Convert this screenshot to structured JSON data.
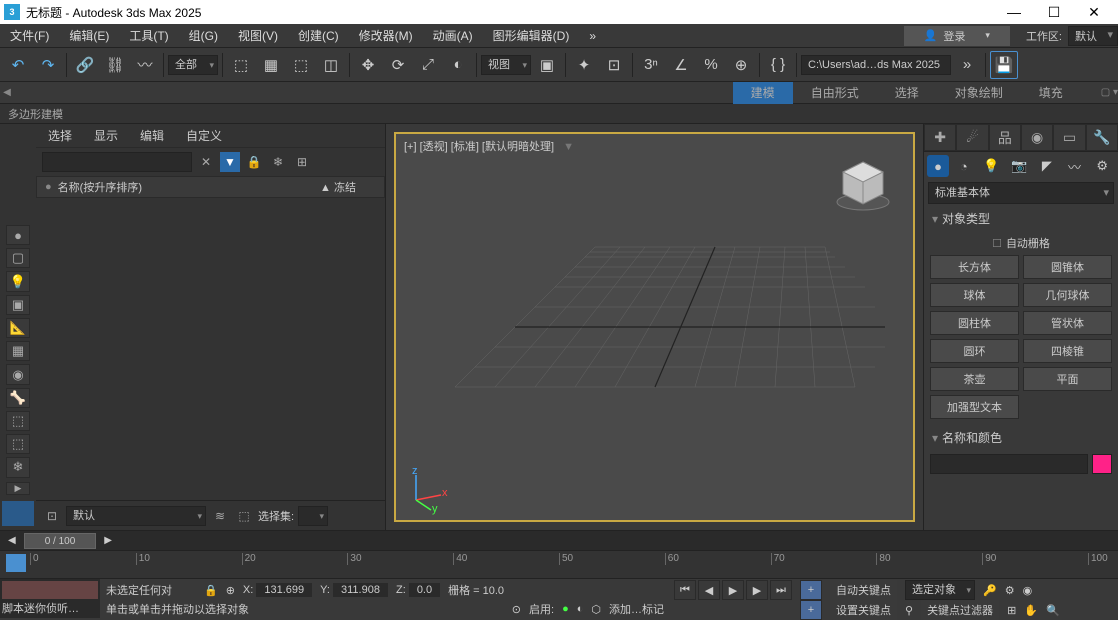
{
  "title": "无标题 - Autodesk 3ds Max 2025",
  "menus": [
    "文件(F)",
    "编辑(E)",
    "工具(T)",
    "组(G)",
    "视图(V)",
    "创建(C)",
    "修改器(M)",
    "动画(A)",
    "图形编辑器(D)"
  ],
  "login": "登录",
  "workspace_label": "工作区:",
  "workspace_value": "默认",
  "toolbar": {
    "all": "全部",
    "view": "视图",
    "path": "C:\\Users\\ad…ds Max 2025"
  },
  "ribbon": {
    "tabs": [
      "建模",
      "自由形式",
      "选择",
      "对象绘制",
      "填充"
    ],
    "sub": "多边形建模"
  },
  "scene": {
    "tabs": [
      "选择",
      "显示",
      "编辑",
      "自定义"
    ],
    "header_name": "名称(按升序排序)",
    "header_freeze": "▲ 冻结",
    "layer_default": "默认",
    "selset_label": "选择集:"
  },
  "viewport": {
    "label": "[+] [透视] [标准] [默认明暗处理]"
  },
  "cmd": {
    "dd": "标准基本体",
    "roll1": "对象类型",
    "autogrid": "自动栅格",
    "types": [
      "长方体",
      "圆锥体",
      "球体",
      "几何球体",
      "圆柱体",
      "管状体",
      "圆环",
      "四棱锥",
      "茶壶",
      "平面",
      "加强型文本"
    ],
    "roll2": "名称和颜色"
  },
  "timeline": {
    "frame": "0 / 100",
    "ticks": [
      0,
      10,
      20,
      30,
      40,
      50,
      60,
      70,
      80,
      90,
      100
    ]
  },
  "status": {
    "script": "脚本迷你侦听…",
    "nosel": "未选定任何对",
    "hint": "单击或单击并拖动以选择对象",
    "x": "X:",
    "xv": "131.699",
    "y": "Y:",
    "yv": "311.908",
    "z": "Z:",
    "zv": "0.0",
    "grid": "栅格 = 10.0",
    "enable": "启用:",
    "add_marker": "添加…标记",
    "autokey": "自动关键点",
    "selobj": "选定对象",
    "setkey": "设置关键点",
    "keyfilter": "关键点过滤器"
  }
}
